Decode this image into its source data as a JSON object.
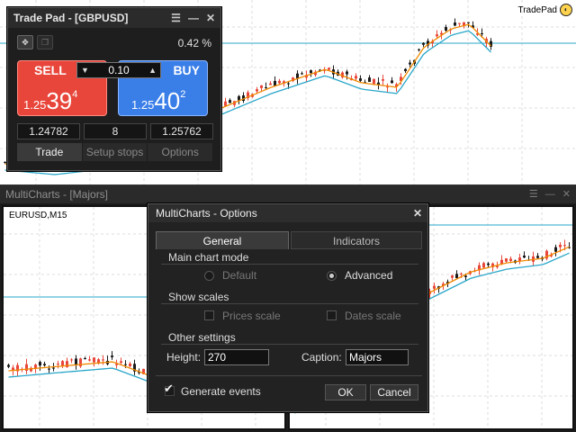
{
  "colors": {
    "bull": "#e8473b",
    "bear": "#1a1a1a",
    "ma": "#f08a00",
    "trend": "#2aa7c9",
    "level": "#2aa7c9"
  },
  "top_chart": {
    "logo_text": "TradePad"
  },
  "tradepad": {
    "title": "Trade Pad - [GBPUSD]",
    "spread": "0.42 %",
    "sell_label": "SELL",
    "buy_label": "BUY",
    "lot": "0.10",
    "sell_price": {
      "small": "1.25",
      "big": "39",
      "sup": "4"
    },
    "buy_price": {
      "small": "1.25",
      "big": "40",
      "sup": "2"
    },
    "info": [
      "1.24782",
      "8",
      "1.25762"
    ],
    "tabs": [
      "Trade",
      "Setup stops",
      "Options"
    ]
  },
  "multicharts": {
    "title": "MultiCharts - [Majors]",
    "left_symbol": "EURUSD,M15"
  },
  "dialog": {
    "title": "MultiCharts - Options",
    "tabs": [
      "General",
      "Indicators"
    ],
    "main_chart_mode": "Main chart mode",
    "mode_options": [
      "Default",
      "Advanced"
    ],
    "selected_mode": "Advanced",
    "show_scales": "Show scales",
    "scale_options": [
      "Prices scale",
      "Dates scale"
    ],
    "other_settings": "Other settings",
    "height_label": "Height:",
    "height_value": "270",
    "caption_label": "Caption:",
    "caption_value": "Majors",
    "generate_events": "Generate events",
    "ok": "OK",
    "cancel": "Cancel"
  }
}
